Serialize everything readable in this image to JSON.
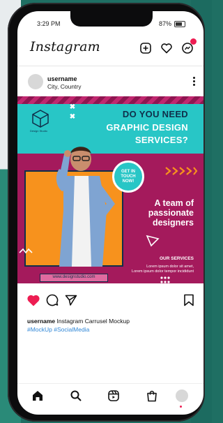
{
  "status": {
    "time": "3:29 PM",
    "battery": "87%"
  },
  "header": {
    "app_name": "Instagram",
    "icons": [
      "new-post-icon",
      "heart-icon",
      "messenger-icon"
    ],
    "accent_color": "#ed1d52"
  },
  "post": {
    "username": "username",
    "location": "City, Country",
    "image": {
      "brand_name": "Design Studio",
      "headline": [
        "DO YOU NEED",
        "GRAPHIC DESIGN",
        "SERVICES?"
      ],
      "cta": [
        "GET IN",
        "TOUCH",
        "NOW!"
      ],
      "tagline": [
        "A team of",
        "passionate",
        "designers"
      ],
      "services_title": "OUR SERVICES",
      "lorem": [
        "Lorem ipsum dolor sit amet,",
        "Lorem ipsum dolor tempor incididunt"
      ],
      "url": "www.designstudio.com",
      "colors": {
        "magenta": "#a41a5c",
        "teal": "#28c6c6",
        "orange": "#f7921d",
        "navy": "#0f2f4a"
      }
    },
    "caption_user": "username",
    "caption_text": "Instagram Carrusel Mockup",
    "hashtags": "#MockUp #SocialMedia",
    "liked": true
  },
  "nav": {
    "items": [
      "home-icon",
      "search-icon",
      "reels-icon",
      "shop-icon",
      "profile-icon"
    ]
  }
}
